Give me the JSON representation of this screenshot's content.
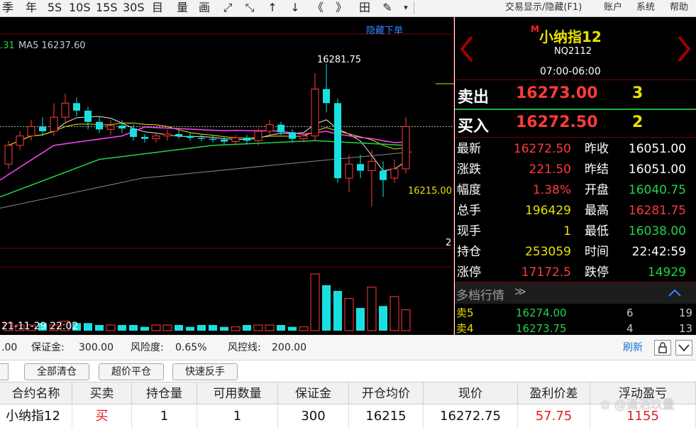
{
  "toolbar": {
    "items": [
      "季",
      "年",
      "5S",
      "10S",
      "15S",
      "30S",
      "目",
      "量",
      "画",
      "⤢",
      "⤡",
      "↑",
      "↓",
      "《",
      "》",
      "田",
      "✎",
      "▾"
    ],
    "menus": [
      "交易显示/隐藏(F1)",
      "账户",
      "系统",
      "帮助"
    ]
  },
  "chart": {
    "hide_orders_label": "隐藏下单",
    "ma_left": ".31",
    "ma5_label": "MA5 16237.60",
    "high_label": "16281.75",
    "price_label": "16215.00",
    "small_label": "2",
    "date_label": "21-11-29 22:02",
    "candles": [
      {
        "o": 16175,
        "c": 16195,
        "h": 16200,
        "l": 16170
      },
      {
        "o": 16195,
        "c": 16205,
        "h": 16210,
        "l": 16190
      },
      {
        "o": 16205,
        "c": 16215,
        "h": 16222,
        "l": 16200
      },
      {
        "o": 16215,
        "c": 16210,
        "h": 16225,
        "l": 16205
      },
      {
        "o": 16210,
        "c": 16225,
        "h": 16240,
        "l": 16205
      },
      {
        "o": 16225,
        "c": 16240,
        "h": 16250,
        "l": 16220
      },
      {
        "o": 16240,
        "c": 16232,
        "h": 16246,
        "l": 16226
      },
      {
        "o": 16232,
        "c": 16220,
        "h": 16236,
        "l": 16212
      },
      {
        "o": 16220,
        "c": 16212,
        "h": 16226,
        "l": 16208
      },
      {
        "o": 16212,
        "c": 16216,
        "h": 16222,
        "l": 16206
      },
      {
        "o": 16216,
        "c": 16213,
        "h": 16222,
        "l": 16208
      },
      {
        "o": 16213,
        "c": 16204,
        "h": 16217,
        "l": 16200
      },
      {
        "o": 16204,
        "c": 16202,
        "h": 16207,
        "l": 16198
      },
      {
        "o": 16202,
        "c": 16205,
        "h": 16209,
        "l": 16198
      },
      {
        "o": 16205,
        "c": 16207,
        "h": 16212,
        "l": 16200
      },
      {
        "o": 16207,
        "c": 16205,
        "h": 16211,
        "l": 16202
      },
      {
        "o": 16205,
        "c": 16203,
        "h": 16208,
        "l": 16200
      },
      {
        "o": 16203,
        "c": 16202,
        "h": 16207,
        "l": 16199
      },
      {
        "o": 16202,
        "c": 16201,
        "h": 16206,
        "l": 16198
      },
      {
        "o": 16201,
        "c": 16199,
        "h": 16204,
        "l": 16196
      },
      {
        "o": 16199,
        "c": 16203,
        "h": 16206,
        "l": 16196
      },
      {
        "o": 16203,
        "c": 16200,
        "h": 16206,
        "l": 16196
      },
      {
        "o": 16200,
        "c": 16210,
        "h": 16213,
        "l": 16195
      },
      {
        "o": 16210,
        "c": 16217,
        "h": 16222,
        "l": 16206
      },
      {
        "o": 16217,
        "c": 16209,
        "h": 16220,
        "l": 16206
      },
      {
        "o": 16209,
        "c": 16202,
        "h": 16212,
        "l": 16198
      },
      {
        "o": 16202,
        "c": 16205,
        "h": 16208,
        "l": 16198
      },
      {
        "o": 16205,
        "c": 16255,
        "h": 16272,
        "l": 16200
      },
      {
        "o": 16255,
        "c": 16240,
        "h": 16281.75,
        "l": 16230
      },
      {
        "o": 16240,
        "c": 16160,
        "h": 16245,
        "l": 16155
      },
      {
        "o": 16160,
        "c": 16175,
        "h": 16185,
        "l": 16145
      },
      {
        "o": 16175,
        "c": 16168,
        "h": 16185,
        "l": 16160
      },
      {
        "o": 16168,
        "c": 16178,
        "h": 16190,
        "l": 16130
      },
      {
        "o": 16168,
        "c": 16158,
        "h": 16178,
        "l": 16140
      },
      {
        "o": 16160,
        "c": 16170,
        "h": 16180,
        "l": 16155
      },
      {
        "o": 16170,
        "c": 16215,
        "h": 16225,
        "l": 16165
      }
    ],
    "volumes": [
      4,
      3,
      3,
      4,
      3,
      5,
      4,
      4,
      3,
      3,
      3,
      3,
      2,
      3,
      3,
      3,
      2,
      3,
      3,
      2,
      2,
      3,
      3,
      3,
      3,
      2,
      2,
      30,
      24,
      21,
      17,
      12,
      23,
      13,
      18,
      11
    ]
  },
  "quote": {
    "badge": "M",
    "name": "小纳指12",
    "code": "NQ2112",
    "hours": "07:00-06:00",
    "sell_label": "卖出",
    "sell_price": "16273.00",
    "sell_qty": "3",
    "buy_label": "买入",
    "buy_price": "16272.50",
    "buy_qty": "2",
    "rows": [
      {
        "l1": "最新",
        "v1": "16272.50",
        "c1": "red",
        "l2": "昨收",
        "v2": "16051.00",
        "c2": "white"
      },
      {
        "l1": "涨跌",
        "v1": "221.50",
        "c1": "red",
        "l2": "昨结",
        "v2": "16051.00",
        "c2": "white"
      },
      {
        "l1": "幅度",
        "v1": "1.38%",
        "c1": "red",
        "l2": "开盘",
        "v2": "16040.75",
        "c2": "green"
      },
      {
        "l1": "总手",
        "v1": "196429",
        "c1": "yellow",
        "l2": "最高",
        "v2": "16281.75",
        "c2": "red"
      },
      {
        "l1": "现手",
        "v1": "1",
        "c1": "yellow",
        "l2": "最低",
        "v2": "16038.00",
        "c2": "green"
      },
      {
        "l1": "持仓",
        "v1": "253059",
        "c1": "yellow",
        "l2": "时间",
        "v2": "22:42:59",
        "c2": "white"
      },
      {
        "l1": "涨停",
        "v1": "17172.5",
        "c1": "red",
        "l2": "跌停",
        "v2": "14929",
        "c2": "green"
      }
    ],
    "depth_title": "多档行情",
    "depth": [
      {
        "label": "卖5",
        "price": "16274.00",
        "qty": "6",
        "count": "19"
      },
      {
        "label": "卖4",
        "price": "16273.75",
        "qty": "4",
        "count": "13"
      }
    ]
  },
  "status": {
    "left_value": ".00",
    "margin_label": "保证金:",
    "margin_value": "300.00",
    "risk_label": "风险度:",
    "risk_value": "0.65%",
    "control_label": "风控线:",
    "control_value": "200.00",
    "refresh": "刷新"
  },
  "buttons": [
    "全部清仓",
    "超价平仓",
    "快速反手"
  ],
  "positions": {
    "headers": [
      "合约名称",
      "买卖",
      "持仓量",
      "可用数量",
      "保证金",
      "开仓均价",
      "现价",
      "盈利价差",
      "浮动盈亏"
    ],
    "rows": [
      [
        "小纳指12",
        "买",
        "1",
        "1",
        "300",
        "16215",
        "16272.75",
        "57.75",
        "1155"
      ]
    ]
  },
  "watermark": "潇洒玖量"
}
